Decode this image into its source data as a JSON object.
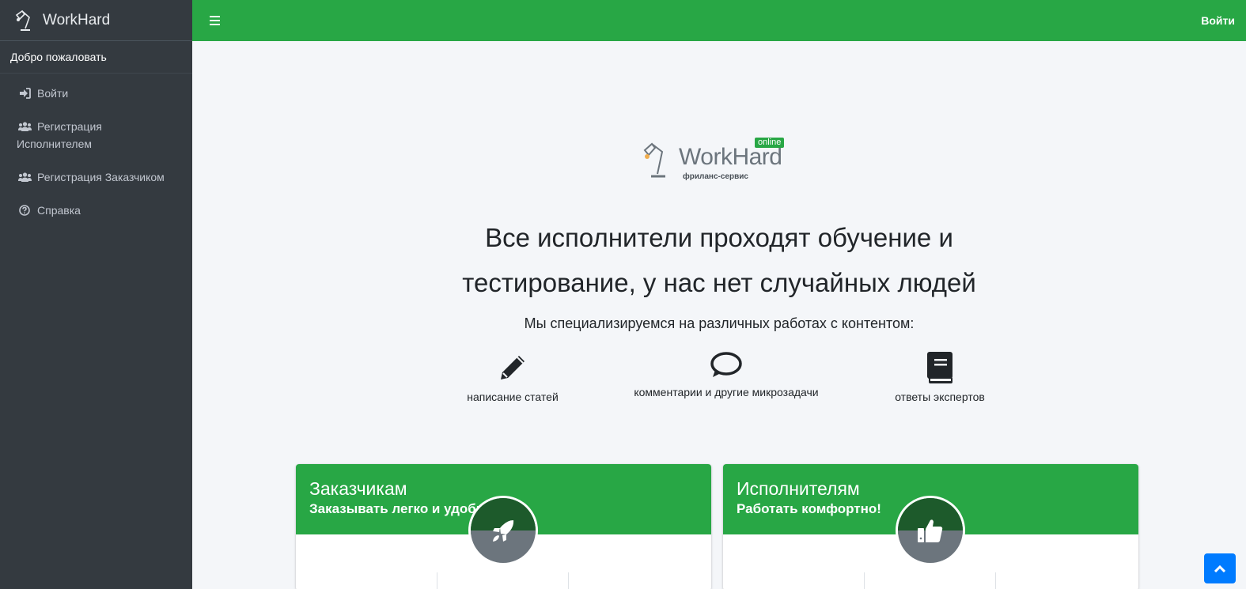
{
  "brand": {
    "name": "WorkHard"
  },
  "sidebar": {
    "welcome": "Добро пожаловать",
    "items": [
      {
        "label": "Войти",
        "icon": "sign-in-icon"
      },
      {
        "label_line1": "Регистрация",
        "label_line2": "Исполнителем",
        "icon": "users-icon"
      },
      {
        "label": "Регистрация Заказчиком",
        "icon": "users-icon"
      },
      {
        "label": "Справка",
        "icon": "question-circle-icon"
      }
    ]
  },
  "topbar": {
    "menu_icon": "hamburger-icon",
    "login": "Войти"
  },
  "logo": {
    "name": "WorkHard",
    "badge": "online",
    "tagline": "фриланс-сервис"
  },
  "hero": {
    "headline_line1": "Все исполнители проходят обучение и",
    "headline_line2": "тестирование, у нас нет случайных людей",
    "subtitle": "Мы специализируемся на различных работах с контентом:"
  },
  "features": [
    {
      "label": "написание статей",
      "icon": "pencil-icon"
    },
    {
      "label": "комментарии и другие микрозадачи",
      "icon": "comment-icon"
    },
    {
      "label": "ответы экспертов",
      "icon": "book-icon"
    }
  ],
  "cards": [
    {
      "title": "Заказчикам",
      "subtitle": "Заказывать легко и удобно!",
      "icon": "rocket-icon"
    },
    {
      "title": "Исполнителям",
      "subtitle": "Работать комфортно!",
      "icon": "thumbs-up-icon"
    }
  ],
  "colors": {
    "accent": "#28a745",
    "sidebar": "#343a40",
    "scroll_button": "#007bff"
  }
}
